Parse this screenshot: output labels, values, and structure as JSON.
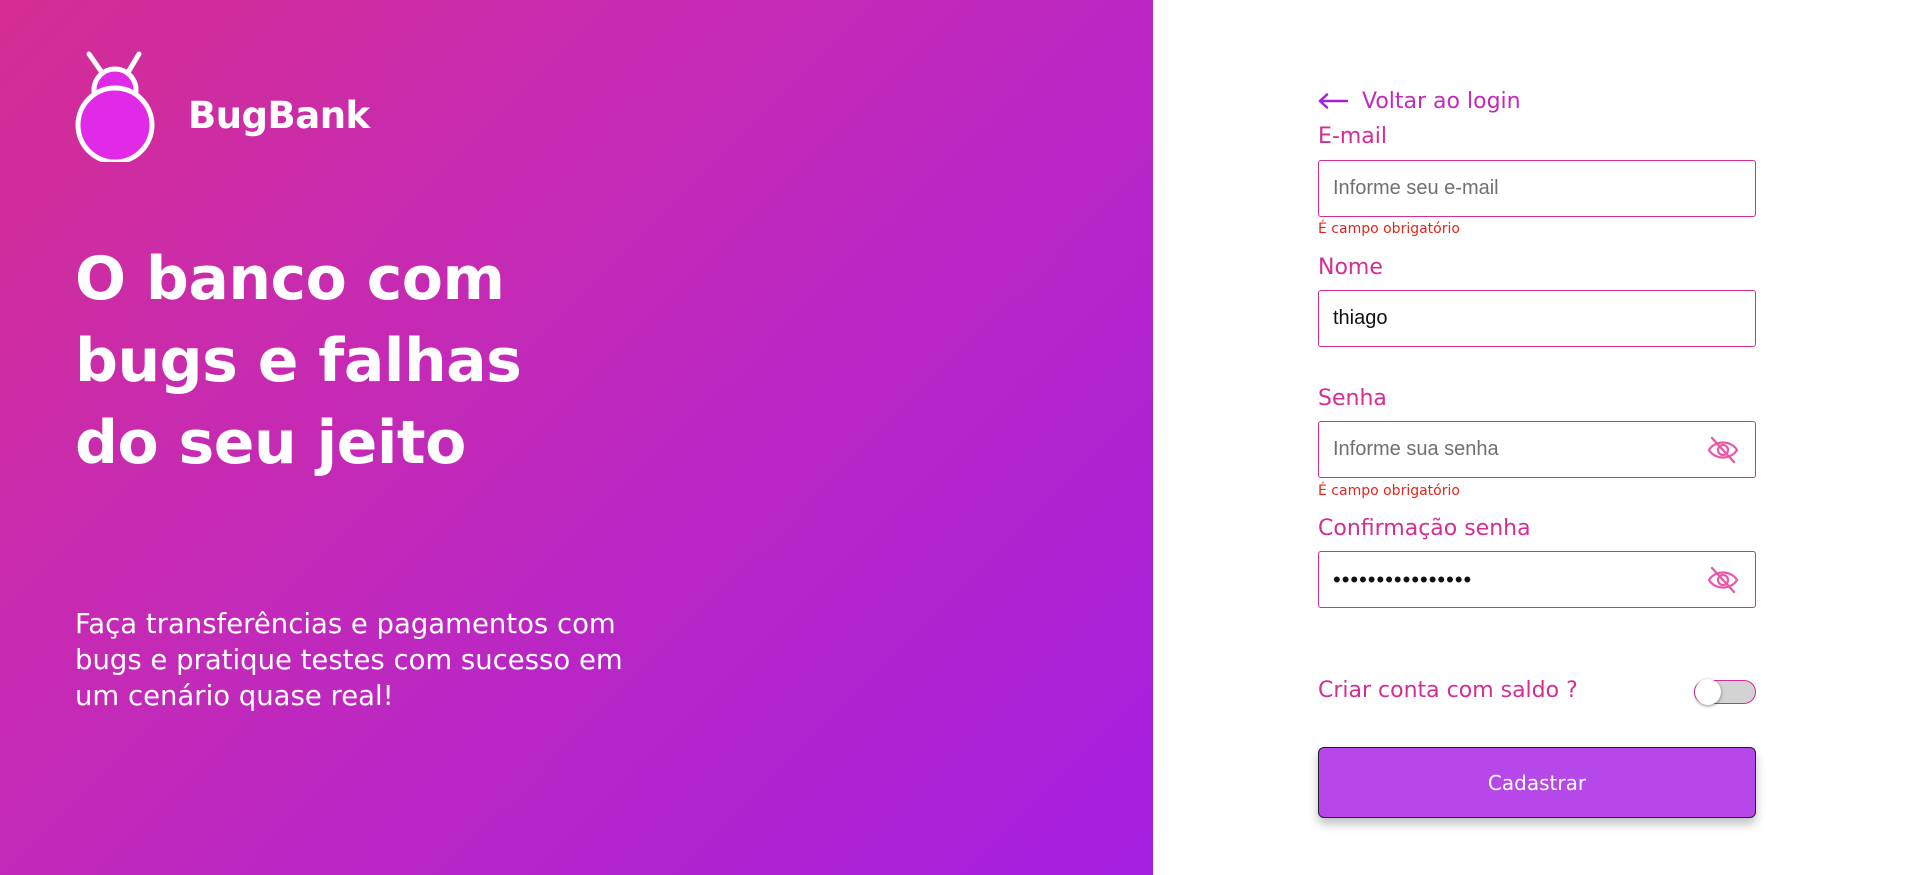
{
  "brand": {
    "name": "BugBank"
  },
  "hero": {
    "headline_lines": [
      "O banco com",
      "bugs e falhas",
      "do seu jeito"
    ],
    "subtext_lines": [
      "Faça transferências e pagamentos com",
      "bugs e pratique testes com sucesso em",
      "um cenário quase real!"
    ]
  },
  "form": {
    "back_link": "Voltar ao login",
    "email": {
      "label": "E-mail",
      "placeholder": "Informe seu e-mail",
      "value": "",
      "error": "É campo obrigatório"
    },
    "name": {
      "label": "Nome",
      "placeholder": "",
      "value": "thiago"
    },
    "password": {
      "label": "Senha",
      "placeholder": "Informe sua senha",
      "value": "",
      "error": "É campo obrigatório"
    },
    "password_confirm": {
      "label": "Confirmação senha",
      "value": "••••••••••••••••"
    },
    "balance_toggle": {
      "label": "Criar conta com saldo ?",
      "checked": false
    },
    "submit_label": "Cadastrar"
  },
  "colors": {
    "gradient_start": "#d42d93",
    "gradient_end": "#a41fe0",
    "accent": "#d42d93",
    "error": "#e2251b",
    "button": "#b647e8"
  },
  "icons": {
    "back": "arrow-left-icon",
    "logo": "bug-logo-icon",
    "password_visibility": "eye-slash-icon"
  }
}
